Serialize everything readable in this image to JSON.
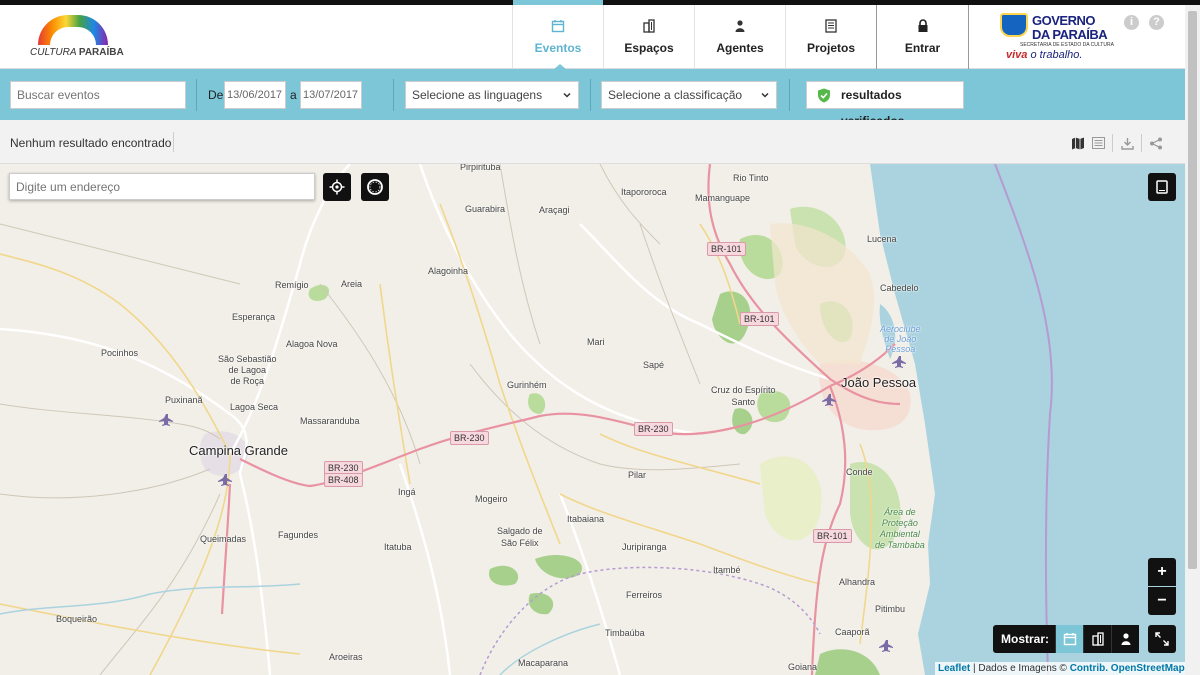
{
  "header": {
    "logo_text_pre": "CULTURA",
    "logo_text_post": "PARAÍBA",
    "tabs": [
      {
        "label": "Eventos",
        "icon": "calendar-icon",
        "active": true
      },
      {
        "label": "Espaços",
        "icon": "building-icon",
        "active": false
      },
      {
        "label": "Agentes",
        "icon": "person-icon",
        "active": false
      },
      {
        "label": "Projetos",
        "icon": "document-icon",
        "active": false
      },
      {
        "label": "Entrar",
        "icon": "lock-icon",
        "active": false
      }
    ],
    "gov_line1": "GOVERNO",
    "gov_line2": "DA PARAÍBA",
    "gov_secretaria": "SECRETARIA DE ESTADO DA CULTURA",
    "gov_slogan_a": "viva",
    "gov_slogan_b": "o trabalho.",
    "info_icon": "i",
    "help_icon": "?"
  },
  "filters": {
    "search_placeholder": "Buscar eventos",
    "from_label": "De",
    "date_from": "13/06/2017",
    "to_label": "a",
    "date_to": "13/07/2017",
    "languages_select": "Selecione as linguagens",
    "classification_select": "Selecione a classificação",
    "verified_label": "resultados verificados"
  },
  "results": {
    "status": "Nenhum resultado encontrado"
  },
  "map": {
    "address_placeholder": "Digite um endereço",
    "zoom_in": "+",
    "zoom_out": "−",
    "show_label": "Mostrar:",
    "attribution_leaflet": "Leaflet",
    "attribution_mid": " | Dados e Imagens © ",
    "attribution_osm": "Contrib. OpenStreetMap",
    "attribution_end": ",",
    "labels": {
      "pirpirituba": "Pirpirituba",
      "rio_tinto": "Rio Tinto",
      "itapororoca": "Itapororoca",
      "mamanguape": "Mamanguape",
      "guarabira": "Guarabira",
      "aracagi": "Araçagi",
      "lucena": "Lucena",
      "alagoinha": "Alagoinha",
      "remigio": "Remígio",
      "areia": "Areia",
      "cabedelo": "Cabedelo",
      "esperanca": "Esperança",
      "aeroclube": "Aeroclube\nde João\nPessoa",
      "alagoa_nova": "Alagoa Nova",
      "mari": "Mari",
      "pocinhos": "Pocinhos",
      "sao_sebastiao": "São Sebastião\nde Lagoa\nde Roça",
      "sape": "Sapé",
      "joao_pessoa": "João Pessoa",
      "gurinhem": "Gurinhém",
      "cruz": "Cruz do Espírito\nSanto",
      "puxinana": "Puxinanã",
      "lagoa_seca": "Lagoa Seca",
      "massaranduba": "Massaranduba",
      "campina_grande": "Campina Grande",
      "conde": "Conde",
      "pilar": "Pilar",
      "inga": "Ingá",
      "mogeiro": "Mogeiro",
      "area_protecao": "Área de\nProteção\nAmbiental\nde Tambaba",
      "itabaiana": "Itabaiana",
      "salgado": "Salgado de\nSão Félix",
      "queimadas": "Queimadas",
      "fagundes": "Fagundes",
      "itatuba": "Itatuba",
      "juripiranga": "Juripiranga",
      "itambe": "Itambé",
      "alhandra": "Alhandra",
      "ferreiros": "Ferreiros",
      "boqueirao": "Boqueirão",
      "pitimbu": "Pitimbu",
      "timbauba": "Timbaúba",
      "caapora": "Caaporã",
      "aroeiras": "Aroeiras",
      "macaparana": "Macaparana",
      "goiana": "Goiana"
    },
    "roads": {
      "br101_a": "BR-101",
      "br101_b": "BR-101",
      "br230_a": "BR-230",
      "br230_b": "BR-230",
      "br230_c": "BR-230",
      "br408": "BR-408",
      "br101_c": "BR-101"
    }
  },
  "colors": {
    "accent": "#7cc6d8",
    "active_tab": "#5fb4cf",
    "sea": "#aad3df",
    "road": "#e892a2"
  }
}
